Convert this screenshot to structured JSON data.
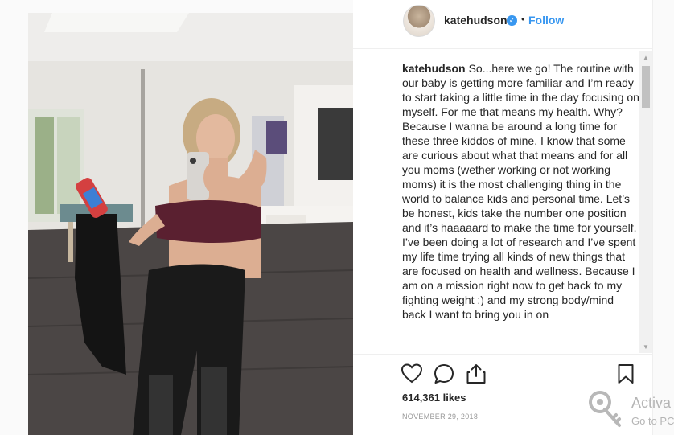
{
  "post": {
    "username": "katehudson",
    "verified_glyph": "✓",
    "dot": "•",
    "follow_label": "Follow",
    "caption_user": "katehudson",
    "caption_text": "So...here we go! The routine with our baby is getting more familiar and I’m ready to start taking a little time in the day focusing on myself. For me that means my health. Why? Because I wanna be around a long time for these three kiddos of mine. I know that some are curious about what that means and for all you moms (wether working or not working moms) it is the most challenging thing in the world to balance kids and personal time. Let’s be honest, kids take the number one position and it’s haaaaard to make the time for yourself. I’ve been doing a lot of research and I’ve spent my life time trying all kinds of new things that are focused on health and wellness. Because I am on a mission right now to get back to my fighting weight :) and my strong body/mind back I want to bring you in on",
    "likes": "614,361 likes",
    "date": "NOVEMBER 29, 2018"
  },
  "icons": {
    "like": "heart-icon",
    "comment": "comment-bubble-icon",
    "share": "share-icon",
    "save": "bookmark-icon",
    "verified": "verified-badge-icon",
    "key": "key-icon"
  },
  "scrollbar": {
    "up_glyph": "▲",
    "down_glyph": "▼"
  },
  "overlay": {
    "title": "Activa",
    "subtitle": "Go to PC"
  },
  "colors": {
    "accent": "#3897f0",
    "text": "#262626",
    "muted": "#999999",
    "border": "#efefef"
  }
}
